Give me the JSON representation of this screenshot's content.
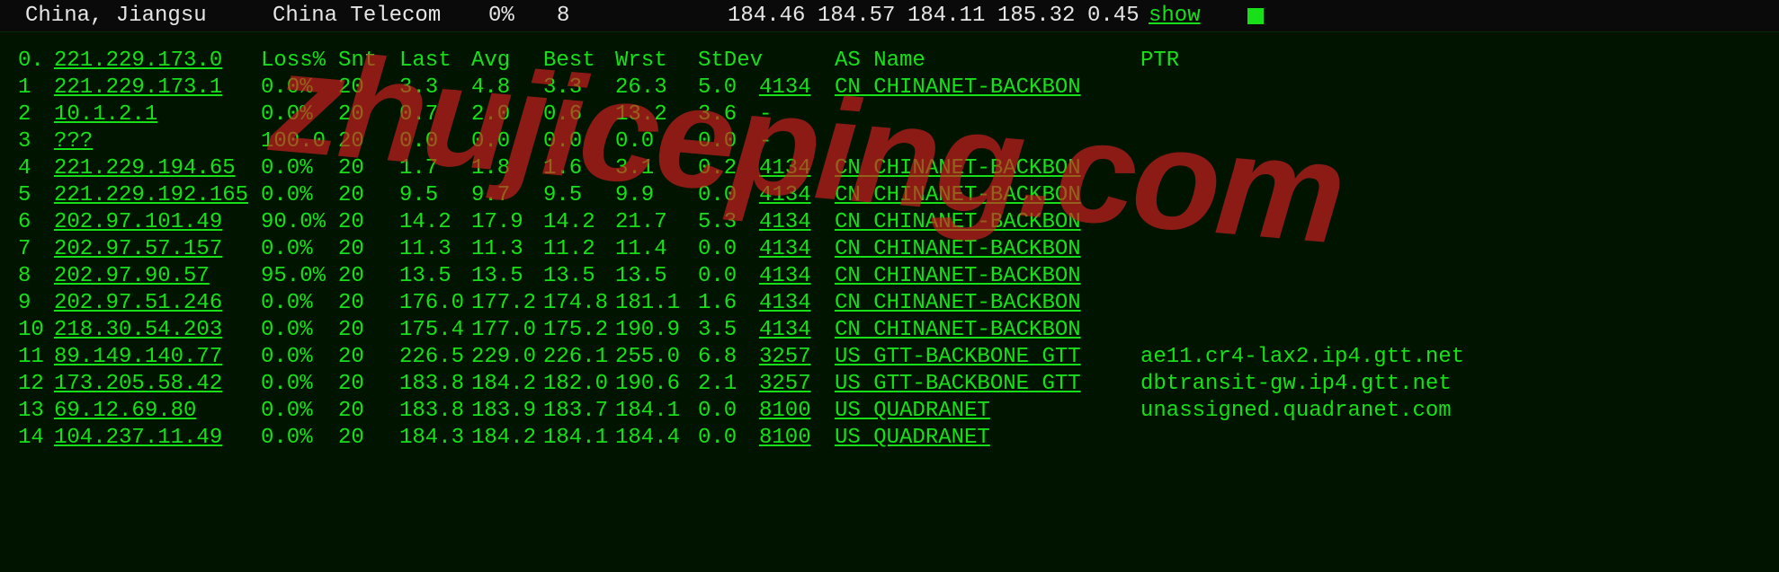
{
  "top": {
    "location": "China, Jiangsu",
    "carrier": "China Telecom",
    "loss": "0%",
    "count": "8",
    "v1": "184.46",
    "v2": "184.57",
    "v3": "184.11",
    "v4": "185.32",
    "v5": "0.45",
    "show": "show"
  },
  "headers": {
    "hop": "0.",
    "ip": "221.229.173.0",
    "loss": "Loss%",
    "snt": "Snt",
    "last": "Last",
    "avg": "Avg",
    "best": "Best",
    "wrst": "Wrst",
    "stdev": "StDev",
    "asname": "AS Name",
    "ptr": "PTR"
  },
  "rows": [
    {
      "hop": "1",
      "ip": "221.229.173.1",
      "loss": "0.0%",
      "snt": "20",
      "last": "3.3",
      "avg": "4.8",
      "best": "3.3",
      "wrst": "26.3",
      "stdev": "5.0",
      "asn": "4134",
      "asname": "CN CHINANET-BACKBON",
      "ptr": ""
    },
    {
      "hop": "2",
      "ip": "10.1.2.1",
      "loss": "0.0%",
      "snt": "20",
      "last": "0.7",
      "avg": "2.0",
      "best": "0.6",
      "wrst": "13.2",
      "stdev": "3.6",
      "asn": "-",
      "asname": "",
      "ptr": ""
    },
    {
      "hop": "3",
      "ip": "???",
      "loss": "100.0",
      "snt": "20",
      "last": "0.0",
      "avg": "0.0",
      "best": "0.0",
      "wrst": "0.0",
      "stdev": "0.0",
      "asn": "-",
      "asname": "",
      "ptr": ""
    },
    {
      "hop": "4",
      "ip": "221.229.194.65",
      "loss": "0.0%",
      "snt": "20",
      "last": "1.7",
      "avg": "1.8",
      "best": "1.6",
      "wrst": "3.1",
      "stdev": "0.2",
      "asn": "4134",
      "asname": "CN CHINANET-BACKBON",
      "ptr": ""
    },
    {
      "hop": "5",
      "ip": "221.229.192.165",
      "loss": "0.0%",
      "snt": "20",
      "last": "9.5",
      "avg": "9.7",
      "best": "9.5",
      "wrst": "9.9",
      "stdev": "0.0",
      "asn": "4134",
      "asname": "CN CHINANET-BACKBON",
      "ptr": ""
    },
    {
      "hop": "6",
      "ip": "202.97.101.49",
      "loss": "90.0%",
      "snt": "20",
      "last": "14.2",
      "avg": "17.9",
      "best": "14.2",
      "wrst": "21.7",
      "stdev": "5.3",
      "asn": "4134",
      "asname": "CN CHINANET-BACKBON",
      "ptr": ""
    },
    {
      "hop": "7",
      "ip": "202.97.57.157",
      "loss": "0.0%",
      "snt": "20",
      "last": "11.3",
      "avg": "11.3",
      "best": "11.2",
      "wrst": "11.4",
      "stdev": "0.0",
      "asn": "4134",
      "asname": "CN CHINANET-BACKBON",
      "ptr": ""
    },
    {
      "hop": "8",
      "ip": "202.97.90.57",
      "loss": "95.0%",
      "snt": "20",
      "last": "13.5",
      "avg": "13.5",
      "best": "13.5",
      "wrst": "13.5",
      "stdev": "0.0",
      "asn": "4134",
      "asname": "CN CHINANET-BACKBON",
      "ptr": ""
    },
    {
      "hop": "9",
      "ip": "202.97.51.246",
      "loss": "0.0%",
      "snt": "20",
      "last": "176.0",
      "avg": "177.2",
      "best": "174.8",
      "wrst": "181.1",
      "stdev": "1.6",
      "asn": "4134",
      "asname": "CN CHINANET-BACKBON",
      "ptr": ""
    },
    {
      "hop": "10",
      "ip": "218.30.54.203",
      "loss": "0.0%",
      "snt": "20",
      "last": "175.4",
      "avg": "177.0",
      "best": "175.2",
      "wrst": "190.9",
      "stdev": "3.5",
      "asn": "4134",
      "asname": "CN CHINANET-BACKBON",
      "ptr": ""
    },
    {
      "hop": "11",
      "ip": "89.149.140.77",
      "loss": "0.0%",
      "snt": "20",
      "last": "226.5",
      "avg": "229.0",
      "best": "226.1",
      "wrst": "255.0",
      "stdev": "6.8",
      "asn": "3257",
      "asname": "US GTT-BACKBONE GTT",
      "ptr": "ae11.cr4-lax2.ip4.gtt.net"
    },
    {
      "hop": "12",
      "ip": "173.205.58.42",
      "loss": "0.0%",
      "snt": "20",
      "last": "183.8",
      "avg": "184.2",
      "best": "182.0",
      "wrst": "190.6",
      "stdev": "2.1",
      "asn": "3257",
      "asname": "US GTT-BACKBONE GTT",
      "ptr": "dbtransit-gw.ip4.gtt.net"
    },
    {
      "hop": "13",
      "ip": "69.12.69.80",
      "loss": "0.0%",
      "snt": "20",
      "last": "183.8",
      "avg": "183.9",
      "best": "183.7",
      "wrst": "184.1",
      "stdev": "0.0",
      "asn": "8100",
      "asname": "US QUADRANET",
      "ptr": "unassigned.quadranet.com"
    },
    {
      "hop": "14",
      "ip": "104.237.11.49",
      "loss": "0.0%",
      "snt": "20",
      "last": "184.3",
      "avg": "184.2",
      "best": "184.1",
      "wrst": "184.4",
      "stdev": "0.0",
      "asn": "8100",
      "asname": "US QUADRANET",
      "ptr": ""
    }
  ],
  "watermark": "zhujiceping.com"
}
